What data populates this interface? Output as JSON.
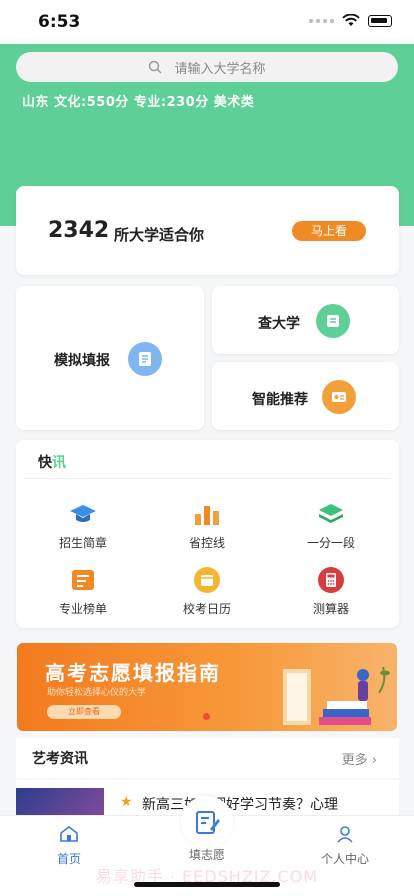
{
  "status": {
    "time": "6:53"
  },
  "colors": {
    "brand_green": "#5dcf97",
    "orange": "#f08a24",
    "tab_active": "#3a7bd5"
  },
  "search": {
    "placeholder": "请输入大学名称"
  },
  "profile": {
    "summary": "山东 文化:550分 专业:230分  美术类"
  },
  "match": {
    "count": "2342",
    "text": "所大学适合你",
    "button": "马上看"
  },
  "tools": {
    "simulate": {
      "label": "模拟填报",
      "icon": "notebook-icon"
    },
    "check": {
      "label": "查大学",
      "icon": "document-icon"
    },
    "recommend": {
      "label": "智能推荐",
      "icon": "id-card-icon"
    }
  },
  "news": {
    "title_a": "快",
    "title_b": "讯",
    "items": [
      {
        "label": "招生简章",
        "icon": "graduation-cap-icon"
      },
      {
        "label": "省控线",
        "icon": "bar-chart-icon"
      },
      {
        "label": "一分一段",
        "icon": "layers-icon"
      },
      {
        "label": "专业榜单",
        "icon": "list-icon"
      },
      {
        "label": "校考日历",
        "icon": "calendar-icon"
      },
      {
        "label": "测算器",
        "icon": "calculator-icon"
      }
    ]
  },
  "banner": {
    "title": "高考志愿填报指南",
    "subtitle": "助你轻松选择心仪的大学",
    "button": "立即查看"
  },
  "art": {
    "title": "艺考资讯",
    "more": "更多"
  },
  "article": {
    "text": "新高三如何调好学习节奏？心理"
  },
  "tabs": {
    "home": "首页",
    "fill": "填志愿",
    "me": "个人中心"
  },
  "watermark": "易享助手 · EEDSHZIZ.COM"
}
